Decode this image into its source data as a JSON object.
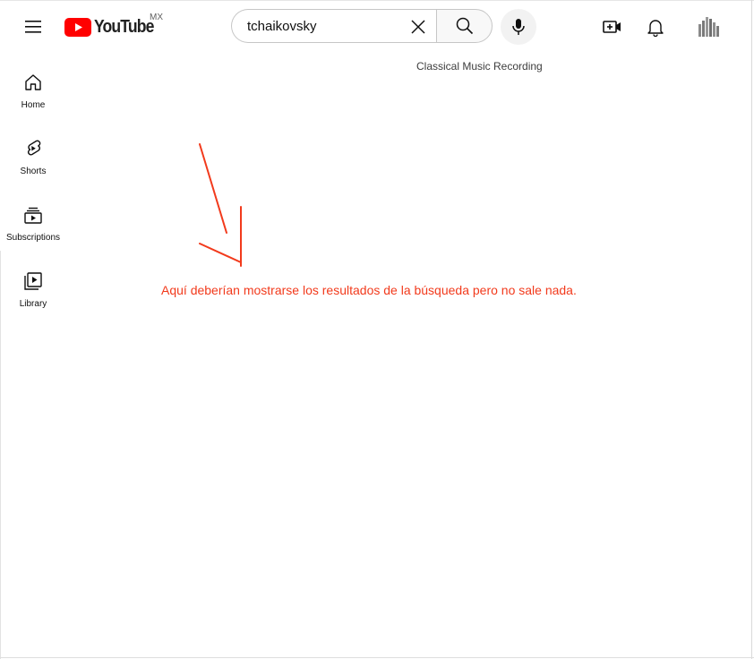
{
  "header": {
    "logo_text": "YouTube",
    "region": "MX",
    "search": {
      "value": "tchaikovsky"
    },
    "topic_chip": "Classical Music Recording"
  },
  "sidebar": {
    "items": [
      {
        "label": "Home",
        "icon": "home-icon"
      },
      {
        "label": "Shorts",
        "icon": "shorts-icon"
      },
      {
        "label": "Subscriptions",
        "icon": "subscriptions-icon"
      },
      {
        "label": "Library",
        "icon": "library-icon"
      }
    ]
  },
  "annotation": {
    "text": "Aquí deberían mostrarse los resultados de la búsqueda pero no sale nada.",
    "color": "#f23a1c"
  },
  "colors": {
    "brand_red": "#ff0000",
    "annotation": "#f23a1c"
  }
}
